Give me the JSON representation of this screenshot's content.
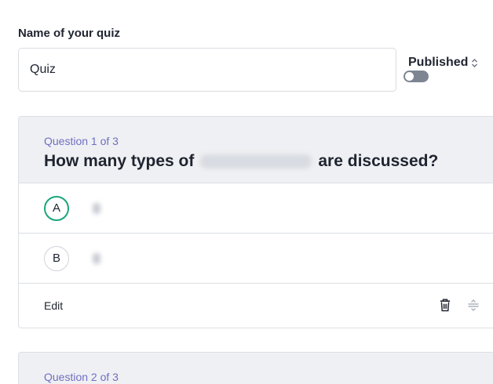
{
  "quiz": {
    "name_label": "Name of your quiz",
    "name_value": "Quiz"
  },
  "published": {
    "label": "Published",
    "enabled": false
  },
  "questions": [
    {
      "counter": "Question 1 of 3",
      "title_prefix": "How many types of",
      "title_suffix": "are discussed?",
      "answers": [
        {
          "letter": "A",
          "correct": true
        },
        {
          "letter": "B",
          "correct": false
        }
      ],
      "edit_label": "Edit"
    },
    {
      "counter": "Question 2 of 3"
    }
  ],
  "colors": {
    "accent": "#6f6fc2",
    "correct": "#1aa67a",
    "header_bg": "#eff0f3"
  }
}
